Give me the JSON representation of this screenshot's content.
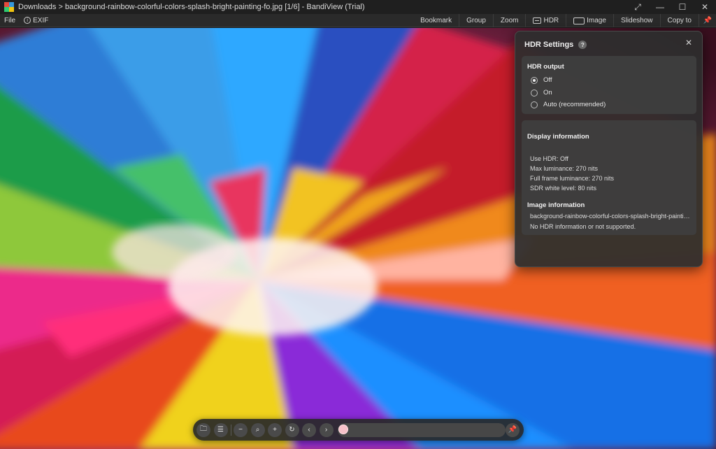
{
  "window": {
    "title": "Downloads > background-rainbow-colorful-colors-splash-bright-painting-fo.jpg [1/6] - BandiView (Trial)",
    "icons": {
      "expand": "expand-icon",
      "minimize": "minimize-icon",
      "maximize": "maximize-icon",
      "close": "close-icon"
    }
  },
  "menubar": {
    "file": "File",
    "exif": "EXIF",
    "right": {
      "bookmark": "Bookmark",
      "group": "Group",
      "zoom": "Zoom",
      "hdr": "HDR",
      "image": "Image",
      "slideshow": "Slideshow",
      "copy_to": "Copy to"
    }
  },
  "hdr_panel": {
    "title": "HDR Settings",
    "help": "?",
    "output": {
      "title": "HDR output",
      "options": [
        "Off",
        "On",
        "Auto (recommended)"
      ],
      "selected": "Off"
    },
    "display": {
      "title": "Display information",
      "use_hdr": "Use HDR: Off",
      "max_lum": "Max luminance: 270 nits",
      "full_lum": "Full frame luminance: 270 nits",
      "sdr_white": "SDR white level: 80 nits"
    },
    "image": {
      "title": "Image information",
      "filename": "background-rainbow-colorful-colors-splash-bright-painting-fo.jpg",
      "status": "No HDR information or not supported."
    }
  },
  "toolbar": {
    "buttons": [
      "open-folder-icon",
      "list-icon",
      "minus-icon",
      "zoom-icon",
      "plus-icon",
      "rotate-icon",
      "chevron-left-icon",
      "chevron-right-icon"
    ],
    "pin": "pin-icon"
  },
  "colors": {
    "panel_bg": "#2e2e2e",
    "section_bg": "#3e3e3e",
    "seek_knob": "#f7c0c9"
  }
}
